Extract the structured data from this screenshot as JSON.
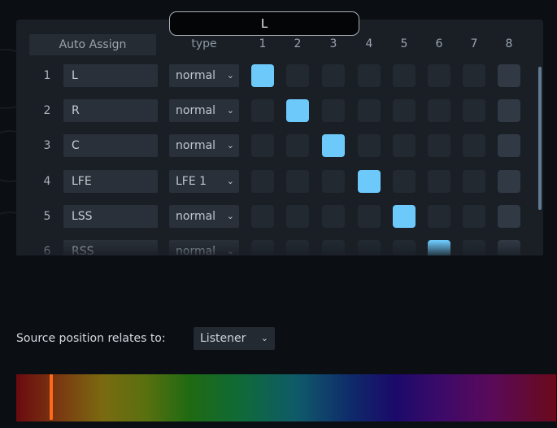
{
  "header": {
    "selected_channel": "L"
  },
  "matrix": {
    "auto_assign_label": "Auto Assign",
    "type_header": "type",
    "columns": [
      "1",
      "2",
      "3",
      "4",
      "5",
      "6",
      "7",
      "8"
    ],
    "rows": [
      {
        "num": "1",
        "name": "L",
        "type": "normal",
        "active_col": 1
      },
      {
        "num": "2",
        "name": "R",
        "type": "normal",
        "active_col": 2
      },
      {
        "num": "3",
        "name": "C",
        "type": "normal",
        "active_col": 3
      },
      {
        "num": "4",
        "name": "LFE",
        "type": "LFE 1",
        "active_col": 4
      },
      {
        "num": "5",
        "name": "LSS",
        "type": "normal",
        "active_col": 5
      },
      {
        "num": "6",
        "name": "RSS",
        "type": "normal",
        "active_col": 6
      }
    ]
  },
  "source_position": {
    "label": "Source position relates to:",
    "value": "Listener"
  },
  "icons": {
    "dropdown": "chevron-down-icon"
  },
  "colors": {
    "active_cell": "#6ec9fb",
    "marker": "#ff6a1a"
  }
}
